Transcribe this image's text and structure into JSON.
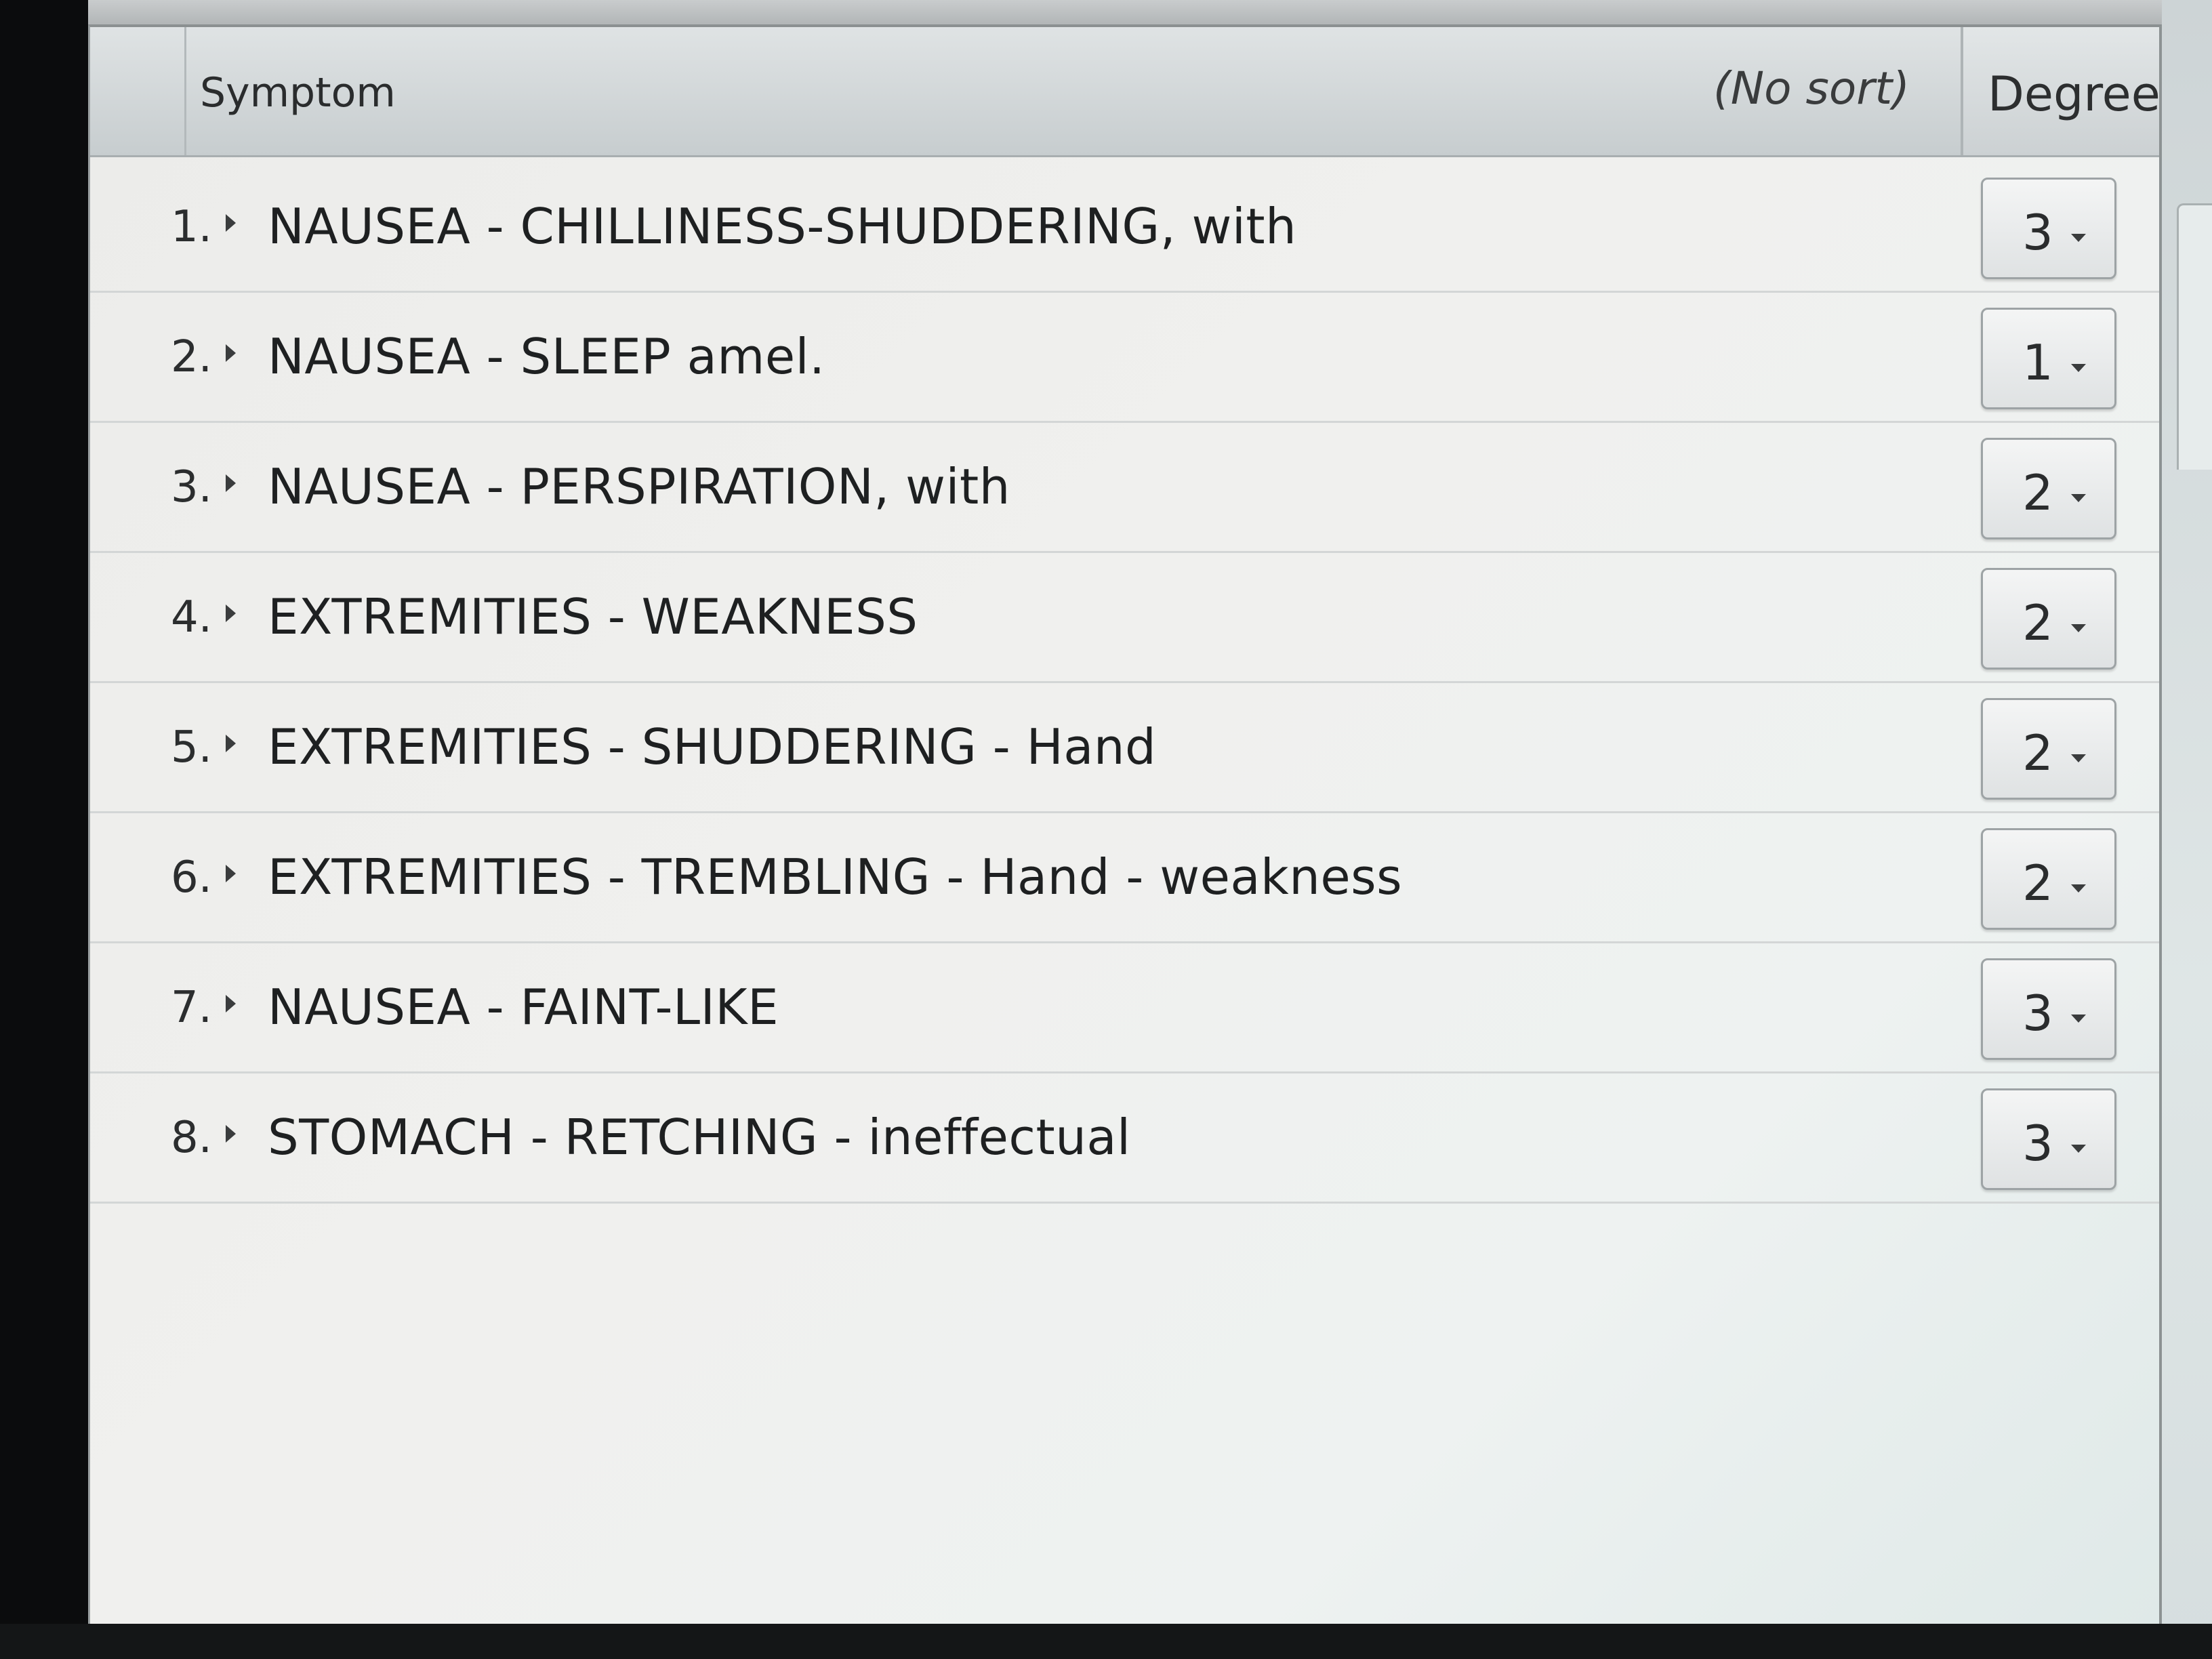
{
  "table": {
    "columns": {
      "symptom": "Symptom",
      "sort": "(No sort)",
      "degree": "Degree"
    },
    "rows": [
      {
        "number": "1.",
        "symptom": "NAUSEA - CHILLINESS-SHUDDERING, with",
        "degree": "3"
      },
      {
        "number": "2.",
        "symptom": "NAUSEA - SLEEP amel.",
        "degree": "1"
      },
      {
        "number": "3.",
        "symptom": "NAUSEA - PERSPIRATION, with",
        "degree": "2"
      },
      {
        "number": "4.",
        "symptom": "EXTREMITIES - WEAKNESS",
        "degree": "2"
      },
      {
        "number": "5.",
        "symptom": "EXTREMITIES - SHUDDERING - Hand",
        "degree": "2"
      },
      {
        "number": "6.",
        "symptom": "EXTREMITIES - TREMBLING - Hand - weakness",
        "degree": "2"
      },
      {
        "number": "7.",
        "symptom": "NAUSEA - FAINT-LIKE",
        "degree": "3"
      },
      {
        "number": "8.",
        "symptom": "STOMACH - RETCHING - ineffectual",
        "degree": "3"
      }
    ]
  },
  "icons": {
    "expander": "triangle-right-icon",
    "dropdown": "caret-down-icon"
  }
}
